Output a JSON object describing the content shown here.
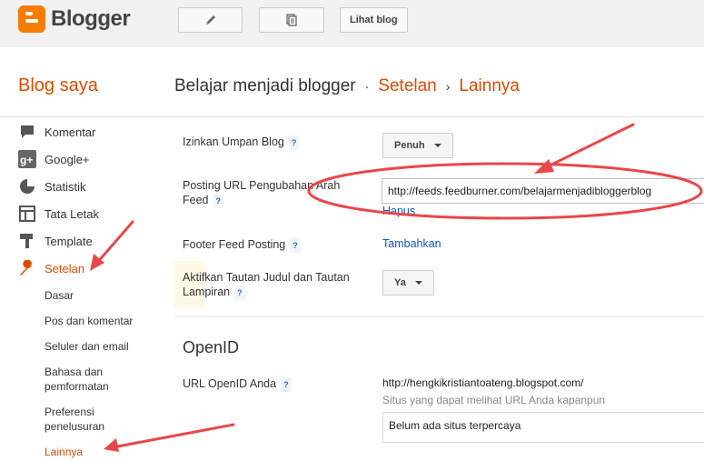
{
  "app": {
    "name": "Blogger"
  },
  "toolbar": {
    "view_blog": "Lihat blog"
  },
  "header": {
    "blog_saya": "Blog saya",
    "blog_title": "Belajar menjadi blogger",
    "sep1": "·",
    "crumb_settings": "Setelan",
    "sep2": "›",
    "crumb_other": "Lainnya"
  },
  "sidebar": {
    "items": [
      {
        "label": "Komentar",
        "icon": "comment-icon"
      },
      {
        "label": "Google+",
        "icon": "googleplus-icon"
      },
      {
        "label": "Statistik",
        "icon": "stats-icon"
      },
      {
        "label": "Tata Letak",
        "icon": "layout-icon"
      },
      {
        "label": "Template",
        "icon": "template-icon"
      },
      {
        "label": "Setelan",
        "icon": "wrench-icon"
      }
    ],
    "subitems": [
      {
        "label": "Dasar"
      },
      {
        "label": "Pos dan komentar"
      },
      {
        "label": "Seluler dan email"
      },
      {
        "label": "Bahasa dan pemformatan"
      },
      {
        "label": "Preferensi penelusuran"
      },
      {
        "label": "Lainnya"
      }
    ]
  },
  "settings": {
    "feed": {
      "label": "Izinkan Umpan Blog",
      "help": "?",
      "value": "Penuh"
    },
    "redirect": {
      "label": "Posting URL Pengubahan Arah Feed",
      "help": "?",
      "value": "http://feeds.feedburner.com/belajarmenjadibloggerblog",
      "delete": "Hapus"
    },
    "footer": {
      "label": "Footer Feed Posting",
      "help": "?",
      "action": "Tambahkan"
    },
    "title_links": {
      "label": "Aktifkan Tautan Judul dan Tautan Lampiran",
      "help": "?",
      "value": "Ya"
    },
    "openid": {
      "heading": "OpenID",
      "label": "URL OpenID Anda",
      "help": "?",
      "url": "http://hengkikristiantoateng.blogspot.com/",
      "trusted_note": "Situs yang dapat melihat URL Anda kapanpun",
      "trusted_value": "Belum ada situs terpercaya"
    }
  },
  "colors": {
    "accent": "#dd4b00",
    "link": "#1155cc",
    "annotation": "#e8474a"
  }
}
